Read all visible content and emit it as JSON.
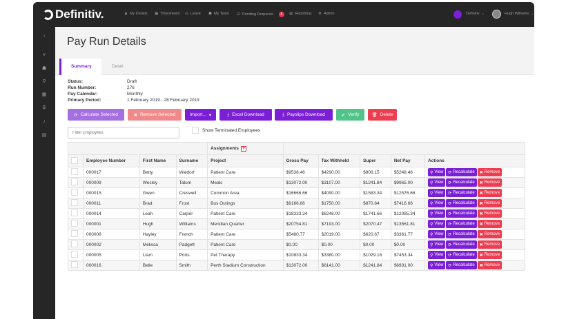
{
  "app": {
    "logo": "Definitiv.",
    "nav": [
      {
        "label": "My Details",
        "icon": "user-icon"
      },
      {
        "label": "Timesheets",
        "icon": "calendar-icon"
      },
      {
        "label": "Leave",
        "icon": "clock-icon"
      },
      {
        "label": "My Team",
        "icon": "team-icon"
      },
      {
        "label": "Pending Requests",
        "icon": "check-square-icon",
        "badge": "5"
      },
      {
        "label": "Reporting",
        "icon": "bar-chart-icon"
      },
      {
        "label": "Admin",
        "icon": "gear-icon"
      }
    ],
    "org": "Definitiv",
    "user": "Hugh Williams"
  },
  "page": {
    "title": "Pay Run Details",
    "tabs": [
      "Summary",
      "Detail"
    ]
  },
  "info": [
    {
      "k": "Status:",
      "v": "Draft"
    },
    {
      "k": "Run Number:",
      "v": "276"
    },
    {
      "k": "Pay Calendar:",
      "v": "Monthly"
    },
    {
      "k": "Primary Period:",
      "v": "1 February 2019 - 28 February 2019"
    }
  ],
  "buttons": {
    "calculate": "Calculate Selected",
    "remove": "Remove Selected",
    "import": "Import...",
    "excel": "Excel Download",
    "payslips": "Payslips Download",
    "verify": "Verify",
    "delete": "Delete"
  },
  "filter": {
    "placeholder": "Filter Employees"
  },
  "show_terminated": "Show Terminated Employees",
  "colors": {
    "purple": "#7b1fd6",
    "light_purple": "#a46fe0",
    "pink": "#f08a8a",
    "green": "#52c48a",
    "red": "#ee3d50",
    "dark": "#262626"
  },
  "table": {
    "group": "Assignments",
    "headers": [
      "Employee Number",
      "First Name",
      "Surname",
      "Project",
      "Gross Pay",
      "Tax Withheld",
      "Super",
      "Net Pay",
      "Actions"
    ],
    "actions": [
      "View",
      "Recalculate",
      "Remove"
    ],
    "rows": [
      [
        "000017",
        "Betty",
        "Waldorf",
        "Patient Care",
        "$9538.46",
        "$4290.00",
        "$906.15",
        "$5248.46"
      ],
      [
        "000009",
        "Wesley",
        "Tatum",
        "Meals",
        "$13072.00",
        "$3107.00",
        "$1241.84",
        "$9965.00"
      ],
      [
        "000015",
        "Gwen",
        "Creswell",
        "Common Area",
        "$16666.66",
        "$4090.00",
        "$1583.34",
        "$12576.66"
      ],
      [
        "000011",
        "Brad",
        "Frost",
        "Bus Outings",
        "$9166.66",
        "$1750.00",
        "$870.84",
        "$7416.66"
      ],
      [
        "000014",
        "Leah",
        "Carper",
        "Patient Care",
        "$18333.34",
        "$6248.00",
        "$1741.66",
        "$12085.34"
      ],
      [
        "000001",
        "Hugh",
        "Williams",
        "Meridian Quarter",
        "$20754.81",
        "$7193.00",
        "$2070.47",
        "$13561.81"
      ],
      [
        "000008",
        "Hayley",
        "French",
        "Patient Care",
        "$5480.77",
        "$2019.00",
        "$620.67",
        "$3361.77"
      ],
      [
        "000002",
        "Melissa",
        "Padgett",
        "Patient Care",
        "$0.00",
        "$0.00",
        "$0.00",
        "$0.00"
      ],
      [
        "000005",
        "Liam",
        "Ports",
        "Pet Therapy",
        "$10833.34",
        "$3380.00",
        "$1029.16",
        "$7453.34"
      ],
      [
        "000016",
        "Belle",
        "Smith",
        "Perth Stadium Construction",
        "$13072.00",
        "$6141.00",
        "$1241.84",
        "$6931.00"
      ]
    ]
  }
}
